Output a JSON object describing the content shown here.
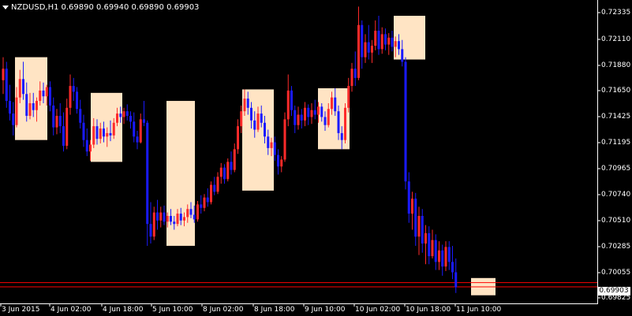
{
  "header": {
    "symbol": "NZDUSD,H1",
    "quote": "0.69890 0.69940 0.69890 0.69903"
  },
  "colors": {
    "background": "#000000",
    "axis": "#ffffff",
    "bull_candle": "#ff2a2a",
    "bear_candle": "#1a1aff",
    "highlight_box": "#ffe4c4",
    "price_line": "#ff0000"
  },
  "price_axis": {
    "ticks": [
      "0.72335",
      "0.72110",
      "0.71880",
      "0.71650",
      "0.71425",
      "0.71195",
      "0.70965",
      "0.70740",
      "0.70510",
      "0.70285",
      "0.70055",
      "0.69825"
    ],
    "current_price": "0.69903"
  },
  "time_axis": {
    "ticks": [
      "3 Jun 2015",
      "4 Jun 02:00",
      "4 Jun 18:00",
      "5 Jun 10:00",
      "8 Jun 02:00",
      "8 Jun 18:00",
      "9 Jun 10:00",
      "10 Jun 02:00",
      "10 Jun 18:00",
      "11 Jun 10:00"
    ]
  },
  "chart_data": {
    "type": "candlestick",
    "symbol": "NZDUSD",
    "timeframe": "H1",
    "ylim": [
      0.6978,
      0.7237
    ],
    "horizontal_lines": [
      0.69903,
      0.6994
    ],
    "highlight_zones": [
      {
        "high": 0.719,
        "low": 0.7118
      },
      {
        "high": 0.7159,
        "low": 0.7099
      },
      {
        "high": 0.7152,
        "low": 0.7026
      },
      {
        "high": 0.7162,
        "low": 0.7074
      },
      {
        "high": 0.7163,
        "low": 0.711
      },
      {
        "high": 0.7226,
        "low": 0.7188
      },
      {
        "high": 0.6998,
        "low": 0.6983
      }
    ],
    "candles": [
      [
        0.717,
        0.719,
        0.7158,
        0.718
      ],
      [
        0.718,
        0.7186,
        0.7146,
        0.7152
      ],
      [
        0.7152,
        0.7166,
        0.7135,
        0.7141
      ],
      [
        0.7141,
        0.7151,
        0.7122,
        0.7131
      ],
      [
        0.7131,
        0.7164,
        0.7129,
        0.7155
      ],
      [
        0.7155,
        0.7179,
        0.715,
        0.7171
      ],
      [
        0.7171,
        0.7186,
        0.7153,
        0.7158
      ],
      [
        0.7158,
        0.7168,
        0.7134,
        0.7139
      ],
      [
        0.7139,
        0.7159,
        0.7136,
        0.715
      ],
      [
        0.715,
        0.7159,
        0.7138,
        0.7144
      ],
      [
        0.7144,
        0.7155,
        0.7134,
        0.7152
      ],
      [
        0.7152,
        0.7169,
        0.7148,
        0.7161
      ],
      [
        0.7161,
        0.7168,
        0.715,
        0.7156
      ],
      [
        0.7156,
        0.7166,
        0.7148,
        0.7164
      ],
      [
        0.7164,
        0.7169,
        0.7143,
        0.7148
      ],
      [
        0.7148,
        0.7155,
        0.7122,
        0.7129
      ],
      [
        0.7129,
        0.7145,
        0.7123,
        0.7139
      ],
      [
        0.7139,
        0.715,
        0.7124,
        0.713
      ],
      [
        0.713,
        0.7142,
        0.7108,
        0.7113
      ],
      [
        0.7113,
        0.7154,
        0.711,
        0.7146
      ],
      [
        0.7146,
        0.7175,
        0.714,
        0.7165
      ],
      [
        0.7165,
        0.7172,
        0.7152,
        0.716
      ],
      [
        0.716,
        0.7164,
        0.7141,
        0.7145
      ],
      [
        0.7145,
        0.7153,
        0.7128,
        0.7133
      ],
      [
        0.7133,
        0.714,
        0.7112,
        0.7118
      ],
      [
        0.7118,
        0.7128,
        0.7104,
        0.7108
      ],
      [
        0.7108,
        0.7118,
        0.71,
        0.7114
      ],
      [
        0.7114,
        0.7137,
        0.7111,
        0.713
      ],
      [
        0.713,
        0.7136,
        0.7114,
        0.7119
      ],
      [
        0.7119,
        0.7133,
        0.7115,
        0.7128
      ],
      [
        0.7128,
        0.7134,
        0.7116,
        0.7121
      ],
      [
        0.7121,
        0.7129,
        0.7112,
        0.7124
      ],
      [
        0.7124,
        0.7135,
        0.7117,
        0.7122
      ],
      [
        0.7122,
        0.7137,
        0.7119,
        0.7133
      ],
      [
        0.7133,
        0.7146,
        0.713,
        0.7141
      ],
      [
        0.7141,
        0.7147,
        0.7133,
        0.7138
      ],
      [
        0.7138,
        0.7146,
        0.7132,
        0.7143
      ],
      [
        0.7143,
        0.7149,
        0.7135,
        0.7139
      ],
      [
        0.7139,
        0.7143,
        0.7128,
        0.7134
      ],
      [
        0.7134,
        0.7142,
        0.7116,
        0.7121
      ],
      [
        0.7121,
        0.7126,
        0.711,
        0.7116
      ],
      [
        0.7116,
        0.7141,
        0.7115,
        0.7136
      ],
      [
        0.7136,
        0.7152,
        0.713,
        0.7133
      ],
      [
        0.7133,
        0.7135,
        0.7026,
        0.7045
      ],
      [
        0.7045,
        0.7064,
        0.7028,
        0.7034
      ],
      [
        0.7034,
        0.706,
        0.7031,
        0.7055
      ],
      [
        0.7055,
        0.7066,
        0.704,
        0.7048
      ],
      [
        0.7048,
        0.706,
        0.7042,
        0.7055
      ],
      [
        0.7055,
        0.7061,
        0.7044,
        0.7047
      ],
      [
        0.7047,
        0.7055,
        0.7042,
        0.7052
      ],
      [
        0.7052,
        0.7058,
        0.7044,
        0.7047
      ],
      [
        0.7047,
        0.7052,
        0.704,
        0.7045
      ],
      [
        0.7045,
        0.7058,
        0.7043,
        0.7054
      ],
      [
        0.7054,
        0.7059,
        0.7044,
        0.7048
      ],
      [
        0.7048,
        0.7055,
        0.7043,
        0.7051
      ],
      [
        0.7051,
        0.7062,
        0.7046,
        0.7058
      ],
      [
        0.7058,
        0.7064,
        0.705,
        0.7053
      ],
      [
        0.7053,
        0.7061,
        0.7046,
        0.7049
      ],
      [
        0.7049,
        0.7065,
        0.7047,
        0.7062
      ],
      [
        0.7062,
        0.707,
        0.7054,
        0.7059
      ],
      [
        0.7059,
        0.7071,
        0.7056,
        0.7068
      ],
      [
        0.7068,
        0.7076,
        0.706,
        0.7064
      ],
      [
        0.7064,
        0.7082,
        0.7062,
        0.7079
      ],
      [
        0.7079,
        0.7086,
        0.707,
        0.7073
      ],
      [
        0.7073,
        0.709,
        0.7071,
        0.7086
      ],
      [
        0.7086,
        0.7098,
        0.708,
        0.7094
      ],
      [
        0.7094,
        0.7097,
        0.708,
        0.7084
      ],
      [
        0.7084,
        0.7102,
        0.7082,
        0.7099
      ],
      [
        0.7099,
        0.7108,
        0.7088,
        0.7092
      ],
      [
        0.7092,
        0.7115,
        0.709,
        0.711
      ],
      [
        0.711,
        0.7136,
        0.7106,
        0.713
      ],
      [
        0.713,
        0.7148,
        0.7124,
        0.7143
      ],
      [
        0.7143,
        0.7162,
        0.7139,
        0.7154
      ],
      [
        0.7154,
        0.716,
        0.714,
        0.7146
      ],
      [
        0.7146,
        0.7151,
        0.7128,
        0.7135
      ],
      [
        0.7135,
        0.7143,
        0.712,
        0.7127
      ],
      [
        0.7127,
        0.7147,
        0.7125,
        0.7141
      ],
      [
        0.7141,
        0.7148,
        0.7129,
        0.7133
      ],
      [
        0.7133,
        0.7139,
        0.7115,
        0.7121
      ],
      [
        0.7121,
        0.7127,
        0.7105,
        0.7111
      ],
      [
        0.7111,
        0.712,
        0.7104,
        0.7116
      ],
      [
        0.7116,
        0.7121,
        0.71,
        0.7105
      ],
      [
        0.7105,
        0.711,
        0.7088,
        0.7095
      ],
      [
        0.7095,
        0.7104,
        0.709,
        0.7101
      ],
      [
        0.7101,
        0.7142,
        0.7099,
        0.7136
      ],
      [
        0.7136,
        0.7175,
        0.713,
        0.7161
      ],
      [
        0.7161,
        0.7165,
        0.7139,
        0.7144
      ],
      [
        0.7144,
        0.7148,
        0.7124,
        0.7131
      ],
      [
        0.7131,
        0.7147,
        0.7127,
        0.714
      ],
      [
        0.714,
        0.7145,
        0.7128,
        0.7135
      ],
      [
        0.7135,
        0.7151,
        0.713,
        0.7146
      ],
      [
        0.7146,
        0.7149,
        0.7131,
        0.7138
      ],
      [
        0.7138,
        0.715,
        0.7132,
        0.7144
      ],
      [
        0.7144,
        0.7153,
        0.7136,
        0.714
      ],
      [
        0.714,
        0.7151,
        0.7133,
        0.7147
      ],
      [
        0.7147,
        0.715,
        0.7134,
        0.7138
      ],
      [
        0.7138,
        0.7143,
        0.7126,
        0.7131
      ],
      [
        0.7131,
        0.715,
        0.7129,
        0.7145
      ],
      [
        0.7145,
        0.716,
        0.714,
        0.7155
      ],
      [
        0.7155,
        0.7163,
        0.7139,
        0.7143
      ],
      [
        0.7143,
        0.7148,
        0.7118,
        0.7124
      ],
      [
        0.7124,
        0.713,
        0.711,
        0.7118
      ],
      [
        0.7118,
        0.715,
        0.7115,
        0.7146
      ],
      [
        0.7146,
        0.7172,
        0.7142,
        0.7165
      ],
      [
        0.7165,
        0.7185,
        0.716,
        0.718
      ],
      [
        0.718,
        0.7195,
        0.7165,
        0.7172
      ],
      [
        0.7172,
        0.7234,
        0.717,
        0.7218
      ],
      [
        0.7218,
        0.7222,
        0.718,
        0.719
      ],
      [
        0.719,
        0.721,
        0.7185,
        0.7203
      ],
      [
        0.7203,
        0.7218,
        0.7188,
        0.7194
      ],
      [
        0.7194,
        0.7205,
        0.7185,
        0.72
      ],
      [
        0.72,
        0.7222,
        0.7196,
        0.7213
      ],
      [
        0.7213,
        0.7226,
        0.7192,
        0.7197
      ],
      [
        0.7197,
        0.7216,
        0.7193,
        0.721
      ],
      [
        0.721,
        0.7215,
        0.7196,
        0.7201
      ],
      [
        0.7201,
        0.7211,
        0.7192,
        0.7207
      ],
      [
        0.7207,
        0.7213,
        0.7195,
        0.7199
      ],
      [
        0.7199,
        0.7208,
        0.719,
        0.7204
      ],
      [
        0.7204,
        0.721,
        0.7192,
        0.7197
      ],
      [
        0.7197,
        0.7205,
        0.7182,
        0.7186
      ],
      [
        0.7186,
        0.719,
        0.7075,
        0.7082
      ],
      [
        0.7082,
        0.709,
        0.7046,
        0.7054
      ],
      [
        0.7054,
        0.7073,
        0.704,
        0.7067
      ],
      [
        0.7067,
        0.7072,
        0.7026,
        0.7034
      ],
      [
        0.7034,
        0.706,
        0.7018,
        0.7052
      ],
      [
        0.7052,
        0.7058,
        0.702,
        0.7028
      ],
      [
        0.7028,
        0.7044,
        0.701,
        0.7037
      ],
      [
        0.7037,
        0.7043,
        0.701,
        0.7017
      ],
      [
        0.7017,
        0.704,
        0.7015,
        0.7031
      ],
      [
        0.7031,
        0.7036,
        0.7005,
        0.7012
      ],
      [
        0.7012,
        0.703,
        0.7005,
        0.7022
      ],
      [
        0.7022,
        0.7027,
        0.7,
        0.7008
      ],
      [
        0.7008,
        0.703,
        0.7004,
        0.7025
      ],
      [
        0.7025,
        0.703,
        0.7005,
        0.7012
      ],
      [
        0.7012,
        0.7026,
        0.6997,
        0.7003
      ],
      [
        0.7003,
        0.7015,
        0.6985,
        0.699
      ]
    ]
  }
}
